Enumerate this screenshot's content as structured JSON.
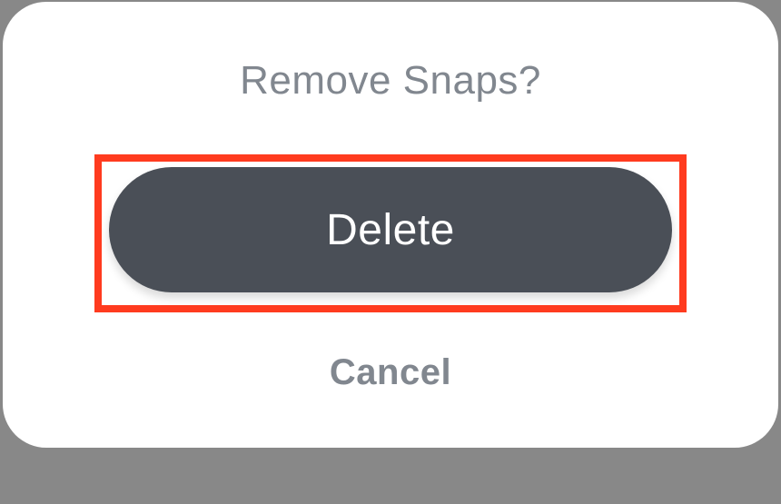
{
  "dialog": {
    "title": "Remove Snaps?",
    "delete_label": "Delete",
    "cancel_label": "Cancel"
  },
  "colors": {
    "highlight": "#ff3b1f",
    "button_bg": "#4a4f57",
    "text_muted": "#81878f"
  }
}
